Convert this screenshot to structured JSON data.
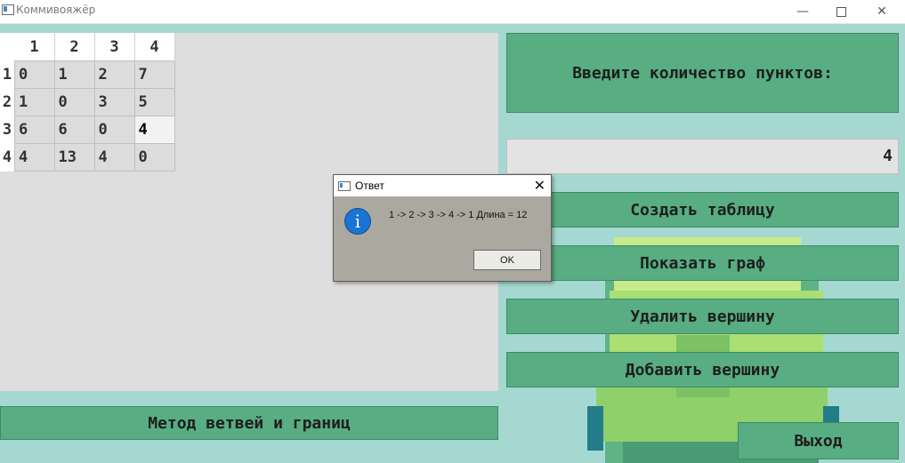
{
  "window": {
    "title": "Коммивояжёр"
  },
  "table": {
    "columns": [
      "1",
      "2",
      "3",
      "4"
    ],
    "rows": [
      {
        "label": "1",
        "cells": [
          "0",
          "1",
          "2",
          "7"
        ]
      },
      {
        "label": "2",
        "cells": [
          "1",
          "0",
          "3",
          "5"
        ]
      },
      {
        "label": "3",
        "cells": [
          "6",
          "6",
          "0",
          "4"
        ]
      },
      {
        "label": "4",
        "cells": [
          "4",
          "13",
          "4",
          "0"
        ]
      }
    ]
  },
  "right": {
    "prompt": "Введите количество пунктов:",
    "count_value": "4",
    "buttons": {
      "create": "Создать таблицу",
      "show_graph": "Показать граф",
      "delete": "Удалить вершину",
      "add": "Добавить вершину",
      "exit": "Выход"
    }
  },
  "bottom": {
    "method_button": "Метод ветвей и границ"
  },
  "dialog": {
    "title": "Ответ",
    "message": "1 -> 2 -> 3 -> 4 -> 1 Длина = 12",
    "ok": "OK"
  },
  "colors": {
    "accent": "#58ad82",
    "background": "#a6d8d2",
    "info": "#1a74d4"
  },
  "icons": [
    "app-icon",
    "minimize-icon",
    "maximize-icon",
    "close-icon",
    "info-icon"
  ]
}
